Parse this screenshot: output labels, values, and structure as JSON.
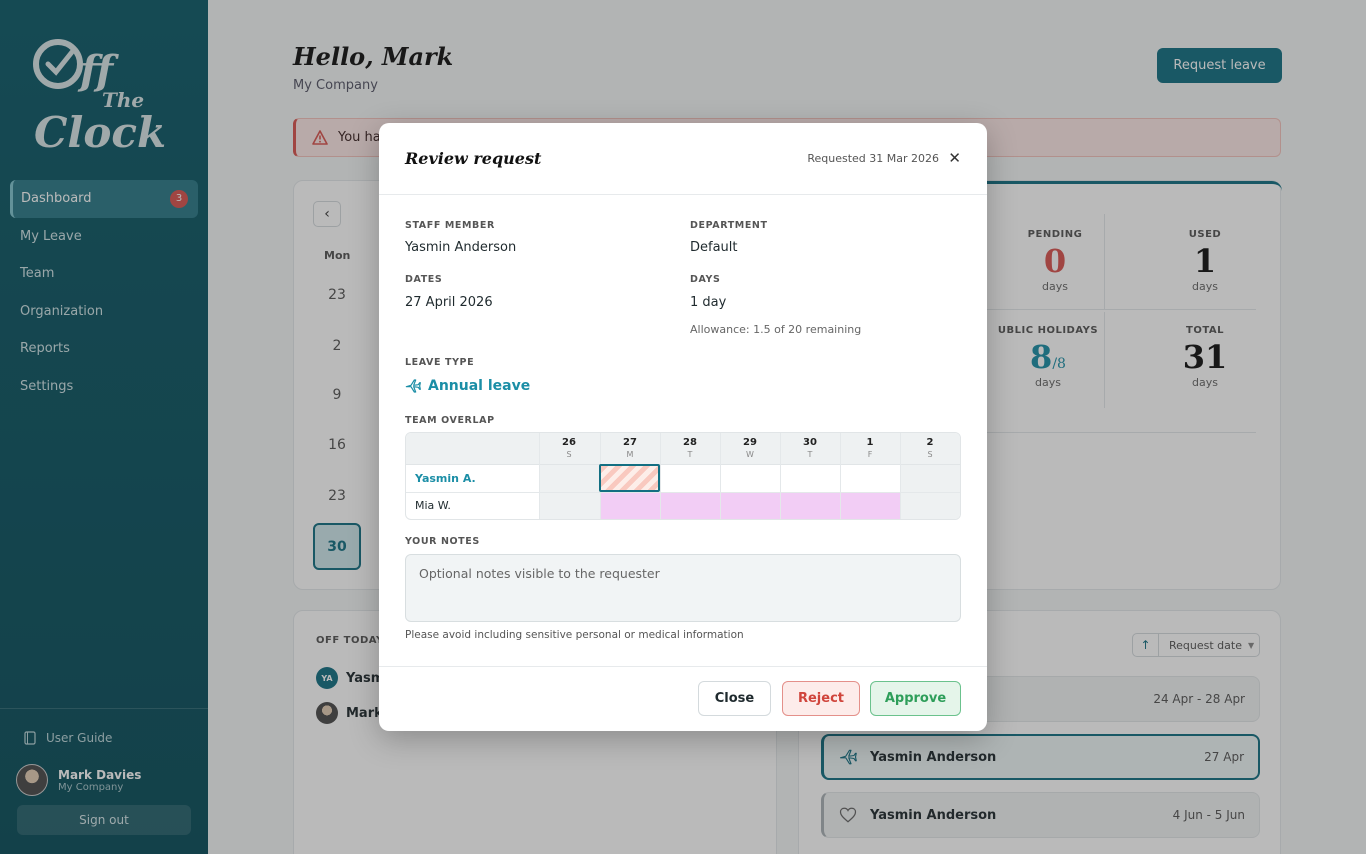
{
  "sidebar": {
    "nav": [
      {
        "label": "Dashboard",
        "badge": "3"
      },
      {
        "label": "My Leave"
      },
      {
        "label": "Team"
      },
      {
        "label": "Organization"
      },
      {
        "label": "Reports"
      },
      {
        "label": "Settings"
      }
    ],
    "guide_label": "User Guide",
    "user_name": "Mark Davies",
    "user_company": "My Company",
    "signout_label": "Sign out"
  },
  "header": {
    "greeting": "Hello, Mark",
    "company": "My Company",
    "request_button": "Request leave"
  },
  "alert": {
    "text": "You hav"
  },
  "calendar": {
    "weekday": "Mon",
    "days": [
      "23",
      "2",
      "9",
      "16",
      "23"
    ],
    "today": "30"
  },
  "stats": [
    {
      "label": "PENDING",
      "value": "0",
      "unit": "days"
    },
    {
      "label": "USED",
      "value": "1",
      "unit": "days"
    },
    {
      "label": "UBLIC HOLIDAYS",
      "value": "8",
      "suffix": "/8",
      "unit": "days"
    },
    {
      "label": "TOTAL",
      "value": "31",
      "unit": "days"
    }
  ],
  "off_today": {
    "title": "OFF TODAY",
    "people": [
      {
        "initials": "YA",
        "name": "Yasmi"
      },
      {
        "name": "Mark I"
      }
    ]
  },
  "requests": {
    "sort_label": "Request date",
    "items": [
      {
        "name": "",
        "dates": "24 Apr - 28 Apr"
      },
      {
        "name": "Yasmin Anderson",
        "dates": "27 Apr"
      },
      {
        "name": "Yasmin Anderson",
        "dates": "4 Jun - 5 Jun"
      }
    ]
  },
  "modal": {
    "title": "Review request",
    "requested": "Requested 31 Mar 2026",
    "staff_label": "STAFF MEMBER",
    "staff_value": "Yasmin Anderson",
    "department_label": "DEPARTMENT",
    "department_value": "Default",
    "dates_label": "DATES",
    "dates_value": "27 April 2026",
    "days_label": "DAYS",
    "days_value": "1 day",
    "allowance": "Allowance: 1.5 of 20 remaining",
    "leave_type_label": "LEAVE TYPE",
    "leave_type_value": "Annual leave",
    "overlap_label": "TEAM OVERLAP",
    "overlap": {
      "days": [
        {
          "d": "26",
          "w": "S"
        },
        {
          "d": "27",
          "w": "M"
        },
        {
          "d": "28",
          "w": "T"
        },
        {
          "d": "29",
          "w": "W"
        },
        {
          "d": "30",
          "w": "T"
        },
        {
          "d": "1",
          "w": "F"
        },
        {
          "d": "2",
          "w": "S"
        }
      ],
      "rows": [
        "Yasmin A.",
        "Mia W."
      ]
    },
    "notes_label": "YOUR NOTES",
    "notes_placeholder": "Optional notes visible to the requester",
    "hint": "Please avoid including sensitive personal or medical information",
    "close_label": "Close",
    "reject_label": "Reject",
    "approve_label": "Approve"
  },
  "colors": {
    "brand": "#136f82",
    "accent": "#1b8ea6",
    "danger": "#d9534f",
    "success": "#2e9e5a",
    "overlap_pink": "#f2cdf5"
  }
}
